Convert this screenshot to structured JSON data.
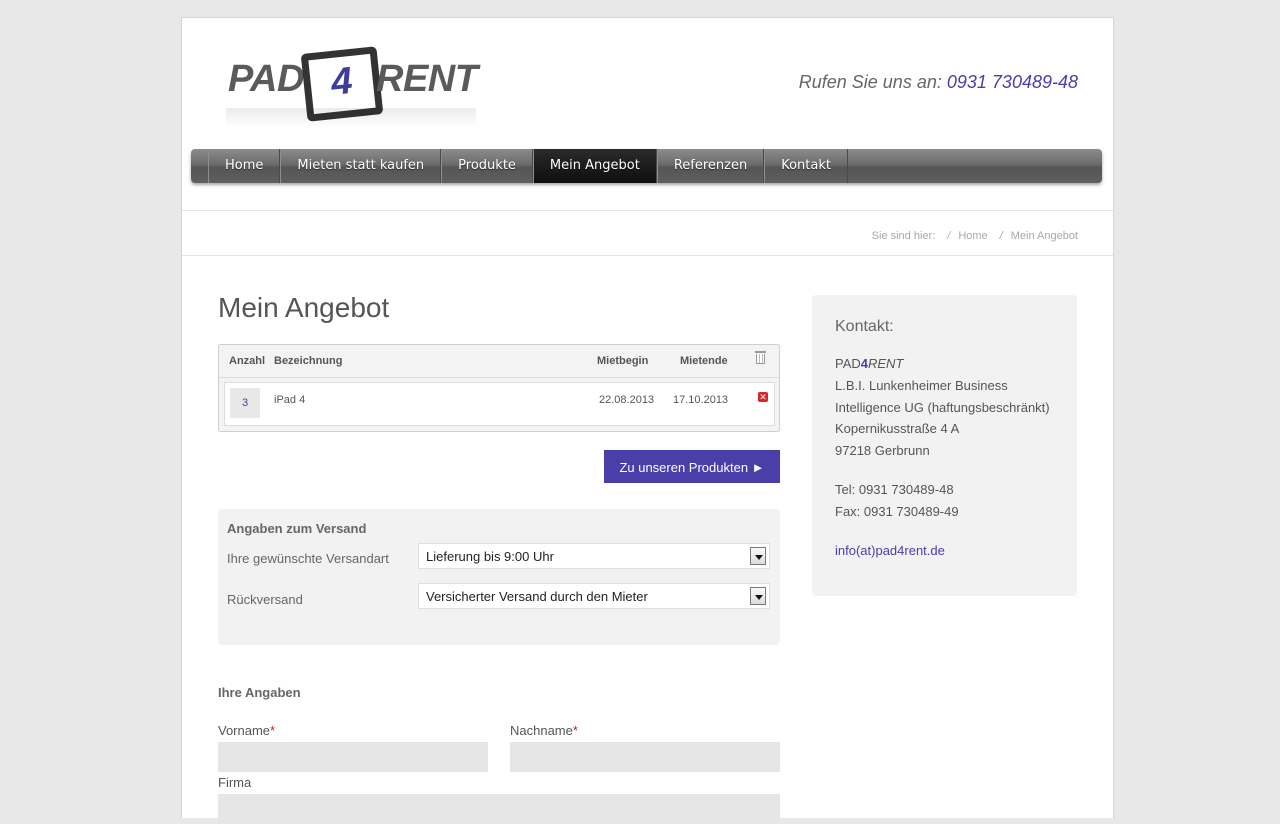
{
  "header": {
    "logo": {
      "pad": "PAD",
      "four": "4",
      "rent": "RENT"
    },
    "callus_label": "Rufen Sie uns an:",
    "callus_phone": "0931 730489-48"
  },
  "nav": {
    "items": [
      {
        "label": "Home"
      },
      {
        "label": "Mieten statt kaufen"
      },
      {
        "label": "Produkte"
      },
      {
        "label": "Mein Angebot",
        "active": true
      },
      {
        "label": "Referenzen"
      },
      {
        "label": "Kontakt"
      }
    ]
  },
  "breadcrumb": {
    "prefix": "Sie sind hier:",
    "separator": "/",
    "items": [
      "Home",
      "Mein Angebot"
    ]
  },
  "main": {
    "title": "Mein Angebot",
    "cart": {
      "headers": {
        "qty": "Anzahl",
        "name": "Bezeichnung",
        "start": "Mietbegin",
        "end": "Mietende"
      },
      "rows": [
        {
          "qty": "3",
          "name": "iPad 4",
          "start": "22.08.2013",
          "end": "17.10.2013"
        }
      ]
    },
    "products_button": "Zu unseren Produkten ►",
    "shipping": {
      "title": "Angaben zum Versand",
      "method_label": "Ihre gewünschte Versandart",
      "method_value": "Lieferung bis 9:00 Uhr",
      "return_label": "Rückversand",
      "return_value": "Versicherter Versand durch den Mieter"
    },
    "personal": {
      "title": "Ihre Angaben",
      "first_name_label": "Vorname",
      "last_name_label": "Nachname",
      "company_label": "Firma",
      "required_mark": "*"
    }
  },
  "sidebar": {
    "title": "Kontakt:",
    "brand": {
      "pad": "PAD",
      "four": "4",
      "rent": "RENT"
    },
    "address": [
      "L.B.I. Lunkenheimer Business",
      "Intelligence UG (haftungsbeschränkt)",
      "Kopernikusstraße 4 A",
      "97218 Gerbrunn"
    ],
    "tel": "Tel:  0931 730489-48",
    "fax": "Fax:  0931 730489-49",
    "email": "info(at)pad4rent.de"
  },
  "colors": {
    "accent": "#4a3ea8",
    "nav_dark": "#555555",
    "panel_bg": "#f2f2f2"
  }
}
